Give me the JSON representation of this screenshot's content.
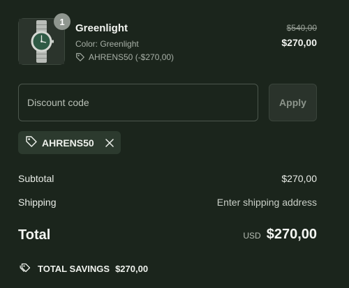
{
  "product": {
    "quantity": "1",
    "name": "Greenlight",
    "variant": "Color: Greenlight",
    "discount_applied": "AHRENS50 (-$270,00)",
    "price_original": "$540,00",
    "price_final": "$270,00",
    "thumbnail_icon": "watch-image"
  },
  "discount": {
    "placeholder": "Discount code",
    "apply_label": "Apply",
    "applied_code": "AHRENS50"
  },
  "summary": {
    "subtotal_label": "Subtotal",
    "subtotal_value": "$270,00",
    "shipping_label": "Shipping",
    "shipping_value": "Enter shipping address",
    "total_label": "Total",
    "currency": "USD",
    "total_value": "$270,00",
    "savings_label": "TOTAL SAVINGS",
    "savings_value": "$270,00"
  },
  "colors": {
    "background": "#1b251c",
    "text": "#eef1ec",
    "muted": "#a8b0a7",
    "badge": "#8f968f"
  }
}
